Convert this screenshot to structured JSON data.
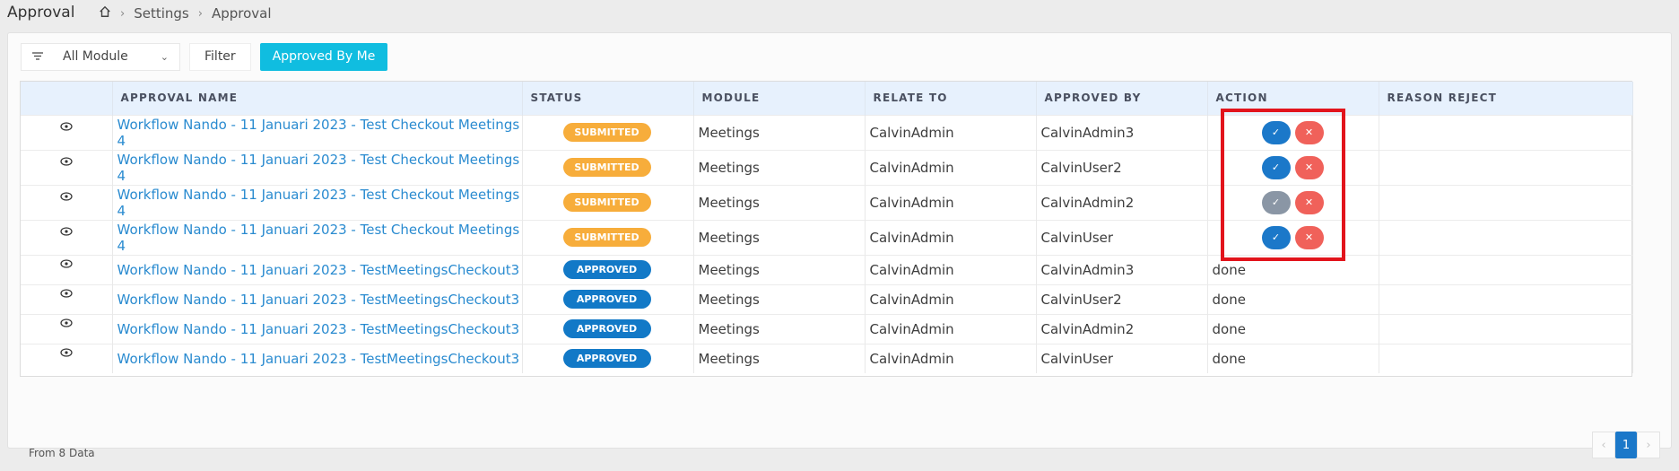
{
  "page": {
    "title": "Approval",
    "breadcrumb": [
      "Settings",
      "Approval"
    ]
  },
  "toolbar": {
    "module_select": "All Module",
    "filter_label": "Filter",
    "approved_by_me_label": "Approved By Me"
  },
  "table": {
    "headers": [
      "",
      "APPROVAL NAME",
      "STATUS",
      "MODULE",
      "RELATE TO",
      "APPROVED BY",
      "ACTION",
      "REASON REJECT"
    ],
    "rows": [
      {
        "name": "Workflow Nando - 11 Januari 2023 - Test Checkout Meetings 4",
        "status": "SUBMITTED",
        "module": "Meetings",
        "relate_to": "CalvinAdmin",
        "approved_by": "CalvinAdmin3",
        "action": "",
        "reason": ""
      },
      {
        "name": "Workflow Nando - 11 Januari 2023 - Test Checkout Meetings 4",
        "status": "SUBMITTED",
        "module": "Meetings",
        "relate_to": "CalvinAdmin",
        "approved_by": "CalvinUser2",
        "action": "",
        "reason": ""
      },
      {
        "name": "Workflow Nando - 11 Januari 2023 - Test Checkout Meetings 4",
        "status": "SUBMITTED",
        "module": "Meetings",
        "relate_to": "CalvinAdmin",
        "approved_by": "CalvinAdmin2",
        "action": "",
        "reason": ""
      },
      {
        "name": "Workflow Nando - 11 Januari 2023 - Test Checkout Meetings 4",
        "status": "SUBMITTED",
        "module": "Meetings",
        "relate_to": "CalvinAdmin",
        "approved_by": "CalvinUser",
        "action": "",
        "reason": ""
      },
      {
        "name": "Workflow Nando - 11 Januari 2023 - TestMeetingsCheckout3",
        "status": "APPROVED",
        "module": "Meetings",
        "relate_to": "CalvinAdmin",
        "approved_by": "CalvinAdmin3",
        "action": "done",
        "reason": ""
      },
      {
        "name": "Workflow Nando - 11 Januari 2023 - TestMeetingsCheckout3",
        "status": "APPROVED",
        "module": "Meetings",
        "relate_to": "CalvinAdmin",
        "approved_by": "CalvinUser2",
        "action": "done",
        "reason": ""
      },
      {
        "name": "Workflow Nando - 11 Januari 2023 - TestMeetingsCheckout3",
        "status": "APPROVED",
        "module": "Meetings",
        "relate_to": "CalvinAdmin",
        "approved_by": "CalvinAdmin2",
        "action": "done",
        "reason": ""
      },
      {
        "name": "Workflow Nando - 11 Januari 2023 - TestMeetingsCheckout3",
        "status": "APPROVED",
        "module": "Meetings",
        "relate_to": "CalvinAdmin",
        "approved_by": "CalvinUser",
        "action": "done",
        "reason": ""
      }
    ]
  },
  "icons": {
    "view": "eye-icon",
    "approve": "check-icon",
    "reject": "close-icon",
    "home": "home-icon",
    "filter": "filter-lines-icon"
  },
  "colors": {
    "accent": "#10bde0",
    "primary": "#1b78c9",
    "submitted": "#f7ad3b",
    "approved": "#1279c7",
    "reject": "#f0615a",
    "highlight": "#e2141c"
  },
  "footer": {
    "count_text": "From 8 Data",
    "current_page": "1"
  }
}
